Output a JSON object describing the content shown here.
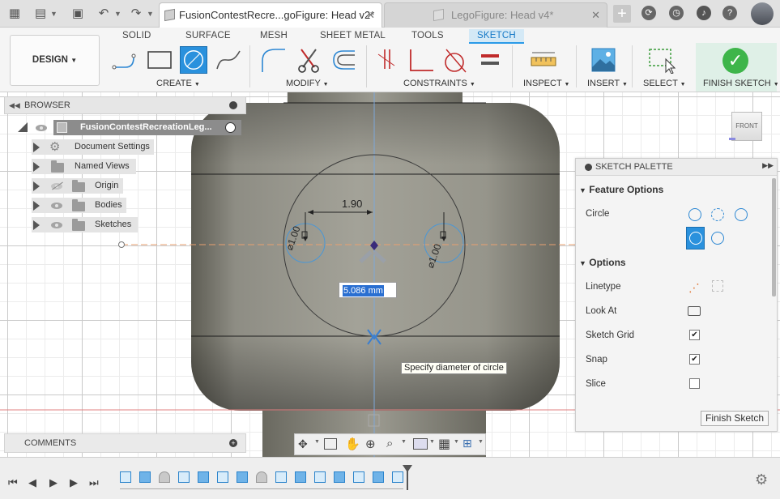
{
  "titlebar": {
    "active_tab": "FusionContestRecre...goFigure: Head v2*",
    "inactive_tab": "LegoFigure: Head v4*",
    "new_tab": "+",
    "help": "?"
  },
  "ribbon": {
    "workspace": "DESIGN",
    "tabs": [
      "SOLID",
      "SURFACE",
      "MESH",
      "SHEET METAL",
      "TOOLS",
      "SKETCH"
    ],
    "groups": {
      "create": "CREATE",
      "modify": "MODIFY",
      "constraints": "CONSTRAINTS",
      "inspect": "INSPECT",
      "insert": "INSERT",
      "select": "SELECT",
      "finish": "FINISH SKETCH"
    }
  },
  "browser": {
    "title": "BROWSER",
    "root": "FusionContestRecreationLeg...",
    "items": [
      "Document Settings",
      "Named Views",
      "Origin",
      "Bodies",
      "Sketches"
    ]
  },
  "sketch": {
    "dim_width": "1.90",
    "dim_left": "⌀1.00",
    "dim_right": "⌀1.00",
    "diameter_input": "5.086 mm",
    "tooltip": "Specify diameter of circle"
  },
  "viewcube": {
    "face": "FRONT"
  },
  "palette": {
    "title": "SKETCH PALETTE",
    "feature_options": "Feature Options",
    "circle_label": "Circle",
    "options": "Options",
    "rows": [
      "Linetype",
      "Look At",
      "Sketch Grid",
      "Snap",
      "Slice"
    ],
    "sketch_grid_checked": true,
    "snap_checked": true,
    "slice_checked": false,
    "finish_button": "Finish Sketch"
  },
  "comments": {
    "title": "COMMENTS"
  },
  "colors": {
    "accent": "#2a91dd",
    "finish_green": "#3eb54a",
    "sketch_tab_bg": "#d4e9f6",
    "model_gray": "#8a8a80"
  }
}
